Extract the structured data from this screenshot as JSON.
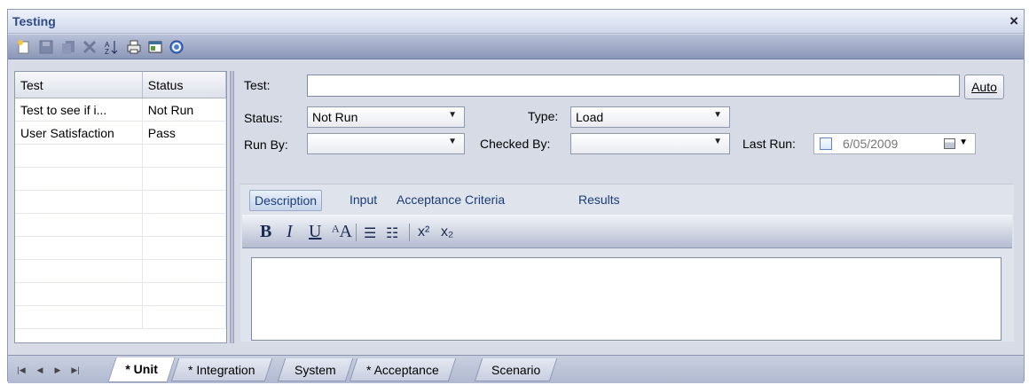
{
  "window": {
    "title": "Testing",
    "close_label": "×"
  },
  "toolbar": {
    "icons": [
      "new-icon",
      "save-icon",
      "copy-icon",
      "delete-icon",
      "sort-icon",
      "print-icon",
      "properties-icon",
      "help-icon"
    ]
  },
  "test_list": {
    "columns": [
      "Test",
      "Status"
    ],
    "rows": [
      {
        "test": "Test to see if i...",
        "status": "Not Run"
      },
      {
        "test": "User Satisfaction",
        "status": "Pass"
      }
    ]
  },
  "details": {
    "test_label": "Test:",
    "test_value": "",
    "auto_button": "Auto",
    "status_label": "Status:",
    "status_value": "Not Run",
    "type_label": "Type:",
    "type_value": "Load",
    "run_by_label": "Run By:",
    "run_by_value": "",
    "checked_by_label": "Checked By:",
    "checked_by_value": "",
    "last_run_label": "Last Run:",
    "last_run_value": "6/05/2009"
  },
  "detail_tabs": [
    "Description",
    "Input",
    "Acceptance Criteria",
    "Results"
  ],
  "format_bar": {
    "bold": "B",
    "italic": "I",
    "underline": "U",
    "font": "ᴬA"
  },
  "bottom_tabs": [
    "* Unit",
    "* Integration",
    "System",
    "* Acceptance",
    "Scenario"
  ],
  "colors": {
    "title_text": "#2d4a88",
    "toolbar": "#8c97b8",
    "panel": "#d7dbe5"
  }
}
